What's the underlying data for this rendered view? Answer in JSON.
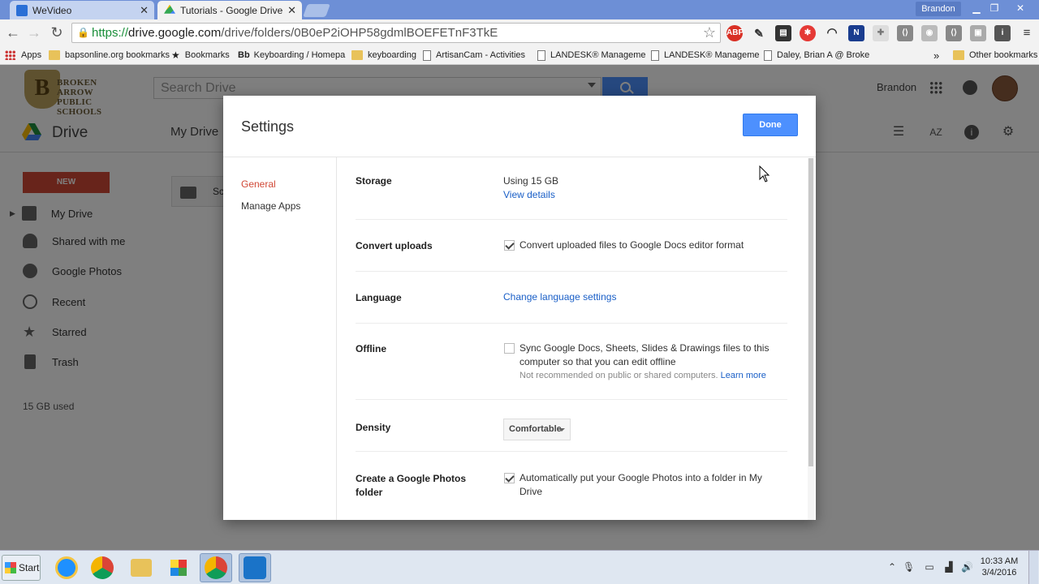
{
  "browser": {
    "tabs": [
      {
        "title": "WeVideo",
        "active": false
      },
      {
        "title": "Tutorials - Google Drive",
        "active": true
      }
    ],
    "profile_name": "Brandon",
    "url_scheme": "https://",
    "url_domain": "drive.google.com",
    "url_path": "/drive/folders/0B0eP2iOHP58gdmlBOEFETnF3TkE",
    "bookmarks": [
      "Apps",
      "bapsonline.org bookmarks",
      "Bookmarks",
      "Keyboarding / Homepa",
      "keyboarding",
      "ArtisanCam - Activities",
      "LANDESK® Manageme",
      "LANDESK® Manageme",
      "Daley, Brian A @ Broke",
      "Other bookmarks"
    ],
    "bookmark_bb_prefix": "Bb",
    "more_bookmarks": "»"
  },
  "drive": {
    "logo_line1": "BROKEN ARROW",
    "logo_line2": "PUBLIC SCHOOLS",
    "logo_letter": "B",
    "search_placeholder": "Search Drive",
    "user_name": "Brandon",
    "app_title": "Drive",
    "breadcrumb": "My Drive",
    "new_button": "NEW",
    "sidebar": [
      {
        "label": "My Drive"
      },
      {
        "label": "Shared with me"
      },
      {
        "label": "Google Photos"
      },
      {
        "label": "Recent"
      },
      {
        "label": "Starred"
      },
      {
        "label": "Trash"
      }
    ],
    "storage_used": "15 GB used",
    "folder_partial": "Sc"
  },
  "settings": {
    "title": "Settings",
    "done_label": "Done",
    "nav": [
      {
        "label": "General",
        "selected": true
      },
      {
        "label": "Manage Apps",
        "selected": false
      }
    ],
    "storage": {
      "label": "Storage",
      "value": "Using 15 GB",
      "link": "View details"
    },
    "convert": {
      "label": "Convert uploads",
      "checked": true,
      "text": "Convert uploaded files to Google Docs editor format"
    },
    "language": {
      "label": "Language",
      "link": "Change language settings"
    },
    "offline": {
      "label": "Offline",
      "checked": false,
      "text_line1": "Sync Google Docs, Sheets, Slides & Drawings files to this",
      "text_line2": "computer so that you can edit offline",
      "note": "Not recommended on public or shared computers.",
      "note_link": "Learn more"
    },
    "density": {
      "label": "Density",
      "value": "Comfortable"
    },
    "photos": {
      "label_line1": "Create a Google Photos",
      "label_line2": "folder",
      "checked": true,
      "text_line1": "Automatically put your Google Photos into a folder in My",
      "text_line2": "Drive"
    }
  },
  "taskbar": {
    "start_label": "Start",
    "time": "10:33 AM",
    "date": "3/4/2016"
  },
  "colors": {
    "accent_blue": "#4d90fe",
    "selected_red": "#d14836",
    "link_blue": "#1a5fc7"
  }
}
